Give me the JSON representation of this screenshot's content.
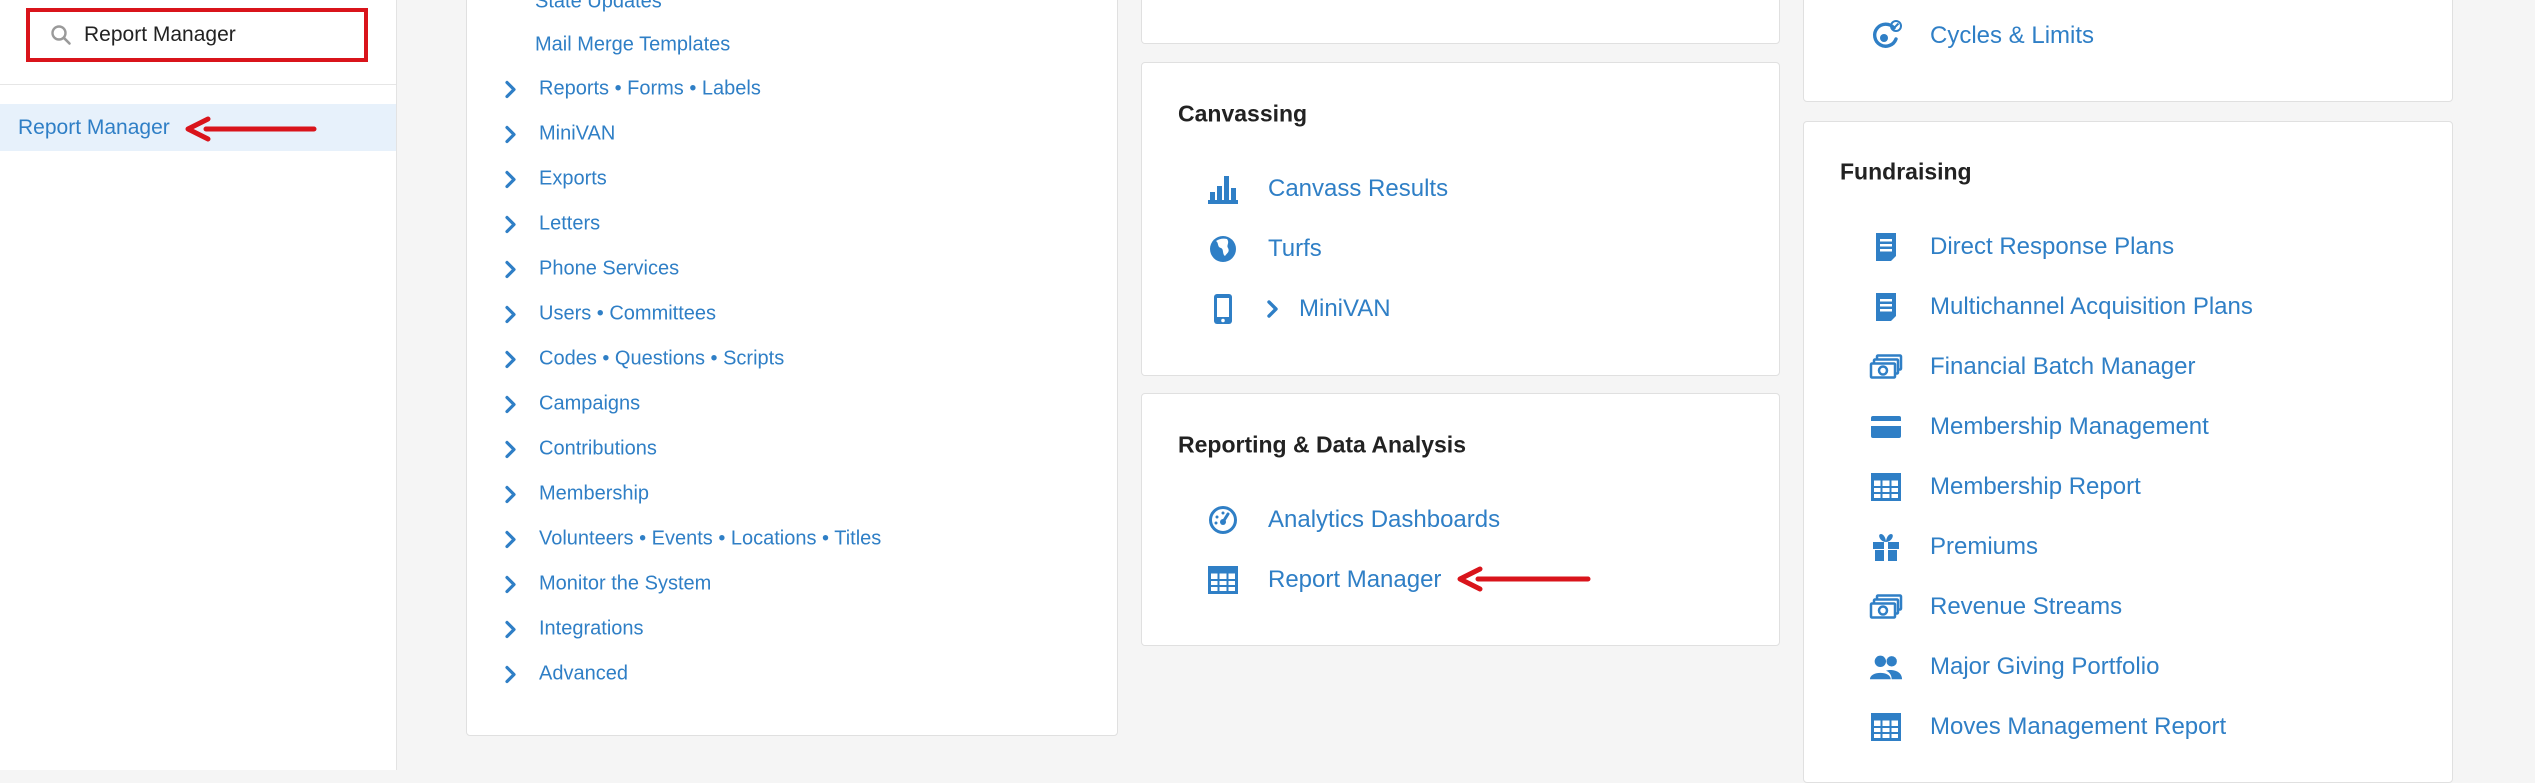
{
  "search": {
    "value": "Report Manager",
    "placeholder": ""
  },
  "sidebar": {
    "result_label": "Report Manager"
  },
  "nav": {
    "top_links": [
      "State Updates",
      "Mail Merge Templates"
    ],
    "items": [
      "Reports • Forms • Labels",
      "MiniVAN",
      "Exports",
      "Letters",
      "Phone Services",
      "Users • Committees",
      "Codes • Questions • Scripts",
      "Campaigns",
      "Contributions",
      "Membership",
      "Volunteers • Events • Locations • Titles",
      "Monitor the System",
      "Integrations",
      "Advanced"
    ]
  },
  "canvassing": {
    "title": "Canvassing",
    "links": [
      {
        "label": "Canvass Results",
        "icon": "bar-chart-icon"
      },
      {
        "label": "Turfs",
        "icon": "globe-icon"
      },
      {
        "label": "MiniVAN",
        "icon": "phone-icon"
      }
    ]
  },
  "reporting": {
    "title": "Reporting & Data Analysis",
    "links": [
      {
        "label": "Analytics Dashboards",
        "icon": "dashboard-icon"
      },
      {
        "label": "Report Manager",
        "icon": "table-icon"
      }
    ]
  },
  "cycles": {
    "label": "Cycles & Limits",
    "icon": "cycle-icon"
  },
  "fundraising": {
    "title": "Fundraising",
    "links": [
      {
        "label": "Direct Response Plans",
        "icon": "document-icon"
      },
      {
        "label": "Multichannel Acquisition Plans",
        "icon": "document-icon"
      },
      {
        "label": "Financial Batch Manager",
        "icon": "money-stack-icon"
      },
      {
        "label": "Membership Management",
        "icon": "card-icon"
      },
      {
        "label": "Membership Report",
        "icon": "table-icon"
      },
      {
        "label": "Premiums",
        "icon": "gift-icon"
      },
      {
        "label": "Revenue Streams",
        "icon": "money-stack-icon"
      },
      {
        "label": "Major Giving Portfolio",
        "icon": "people-icon"
      },
      {
        "label": "Moves Management Report",
        "icon": "table-icon"
      }
    ]
  },
  "colors": {
    "link": "#2f7fc6",
    "annotation_red": "#d9141b",
    "highlight": "#e7f1fb"
  }
}
